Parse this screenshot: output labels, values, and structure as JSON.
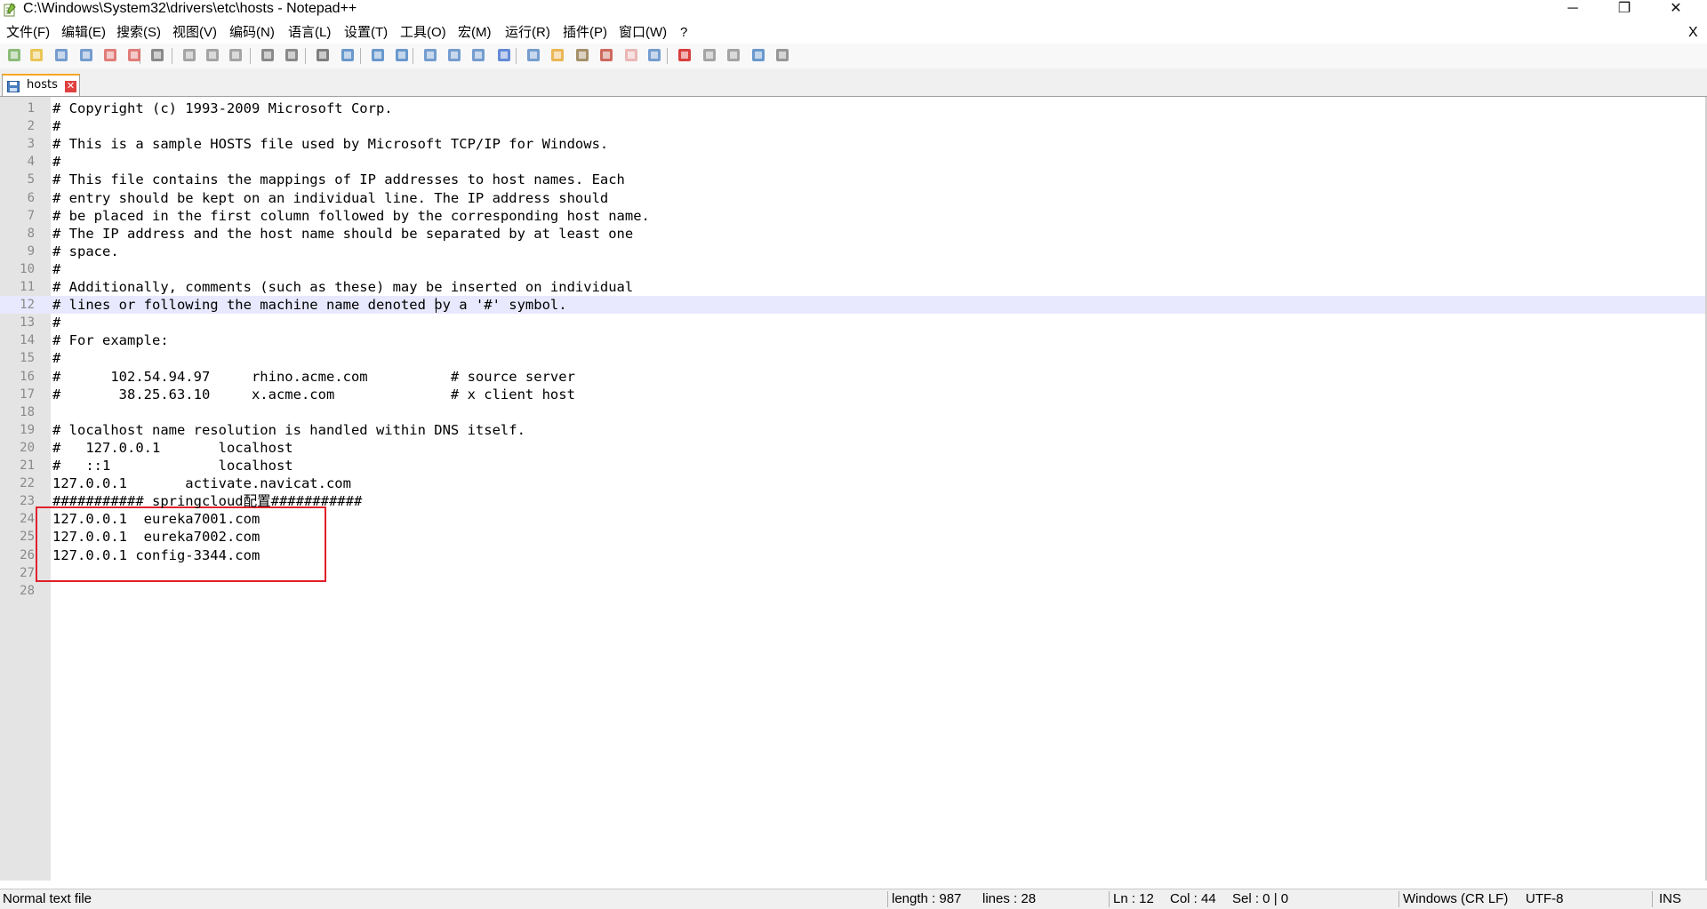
{
  "window": {
    "title": "C:\\Windows\\System32\\drivers\\etc\\hosts - Notepad++",
    "minimize": "─",
    "maximize": "❐",
    "close": "✕"
  },
  "menu": [
    "文件(F)",
    "编辑(E)",
    "搜索(S)",
    "视图(V)",
    "编码(N)",
    "语言(L)",
    "设置(T)",
    "工具(O)",
    "宏(M)",
    "运行(R)",
    "插件(P)",
    "窗口(W)",
    "?"
  ],
  "doc_close": "X",
  "toolbar_icons": [
    "new-file-icon",
    "open-file-icon",
    "save-icon",
    "save-all-icon",
    "close-icon",
    "close-all-icon",
    "print-icon",
    "cut-icon",
    "copy-icon",
    "paste-icon",
    "undo-icon",
    "redo-icon",
    "find-icon",
    "replace-icon",
    "zoom-in-icon",
    "zoom-out-icon",
    "sync-vertical-icon",
    "sync-horizontal-icon",
    "word-wrap-icon",
    "show-all-chars-icon",
    "indent-guide-icon",
    "user-language-icon",
    "document-map-icon",
    "function-list-icon",
    "folder-workspace-icon",
    "monitoring-icon",
    "record-macro-icon",
    "stop-macro-icon",
    "play-macro-icon",
    "run-macro-multiple-icon",
    "save-macro-icon"
  ],
  "tab": {
    "label": "hosts",
    "close": "✕"
  },
  "editor": {
    "current_line": 12,
    "lines": [
      "# Copyright (c) 1993-2009 Microsoft Corp.",
      "#",
      "# This is a sample HOSTS file used by Microsoft TCP/IP for Windows.",
      "#",
      "# This file contains the mappings of IP addresses to host names. Each",
      "# entry should be kept on an individual line. The IP address should",
      "# be placed in the first column followed by the corresponding host name.",
      "# The IP address and the host name should be separated by at least one",
      "# space.",
      "#",
      "# Additionally, comments (such as these) may be inserted on individual",
      "# lines or following the machine name denoted by a '#' symbol.",
      "#",
      "# For example:",
      "#",
      "#      102.54.94.97     rhino.acme.com          # source server",
      "#       38.25.63.10     x.acme.com              # x client host",
      "",
      "# localhost name resolution is handled within DNS itself.",
      "#   127.0.0.1       localhost",
      "#   ::1             localhost",
      "127.0.0.1       activate.navicat.com",
      "########### springcloud配置###########",
      "127.0.0.1  eureka7001.com",
      "127.0.0.1  eureka7002.com",
      "127.0.0.1 config-3344.com",
      "",
      ""
    ]
  },
  "status": {
    "filetype": "Normal text file",
    "length": "length : 987",
    "lines": "lines : 28",
    "ln": "Ln : 12",
    "col": "Col : 44",
    "sel": "Sel : 0 | 0",
    "eol": "Windows (CR LF)",
    "encoding": "UTF-8",
    "mode": "INS"
  },
  "colors": {
    "highlight_box": "#e0202a",
    "current_line": "#e8e8ff",
    "gutter": "#e4e4e4",
    "tab_accent": "#f5a623"
  }
}
